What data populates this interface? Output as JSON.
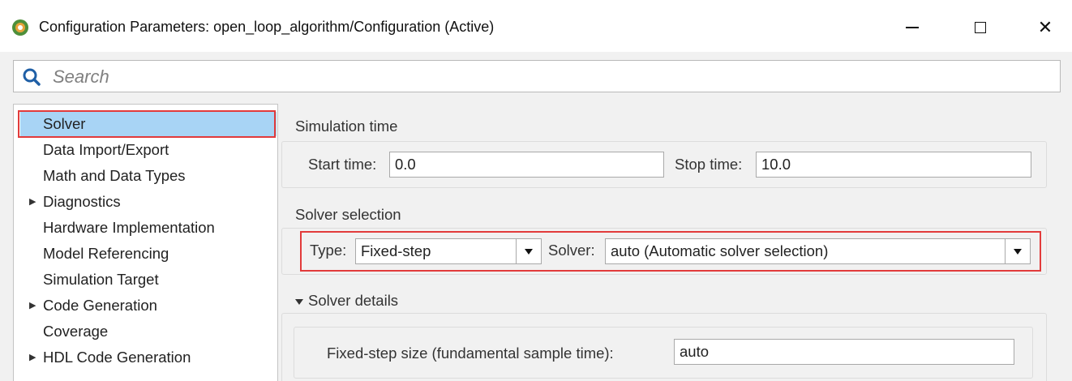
{
  "window": {
    "title": "Configuration Parameters: open_loop_algorithm/Configuration (Active)",
    "app_icon": "matlab-config-icon",
    "controls": [
      "minimize-icon",
      "maximize-icon",
      "close-icon"
    ],
    "close_glyph": "✕"
  },
  "search": {
    "placeholder": "Search",
    "icon": "search-icon"
  },
  "nav": {
    "selected": "Solver",
    "items": [
      {
        "label": "Solver",
        "expandable": false
      },
      {
        "label": "Data Import/Export",
        "expandable": false
      },
      {
        "label": "Math and Data Types",
        "expandable": false
      },
      {
        "label": "Diagnostics",
        "expandable": true
      },
      {
        "label": "Hardware Implementation",
        "expandable": false
      },
      {
        "label": "Model Referencing",
        "expandable": false
      },
      {
        "label": "Simulation Target",
        "expandable": false
      },
      {
        "label": "Code Generation",
        "expandable": true
      },
      {
        "label": "Coverage",
        "expandable": false
      },
      {
        "label": "HDL Code Generation",
        "expandable": true
      }
    ],
    "expand_glyph": "▶"
  },
  "simulation_time": {
    "title": "Simulation time",
    "start_label": "Start time:",
    "start_value": "0.0",
    "stop_label": "Stop time:",
    "stop_value": "10.0"
  },
  "solver_selection": {
    "title": "Solver selection",
    "type_label": "Type:",
    "type_value": "Fixed-step",
    "solver_label": "Solver:",
    "solver_value": "auto (Automatic solver selection)"
  },
  "solver_details": {
    "title": "Solver details",
    "expanded": true,
    "step_label": "Fixed-step size (fundamental sample time):",
    "step_value": "auto"
  },
  "colors": {
    "highlight_box": "#e23b3b",
    "selection": "#a8d4f5",
    "panel_bg": "#f1f1f1"
  }
}
